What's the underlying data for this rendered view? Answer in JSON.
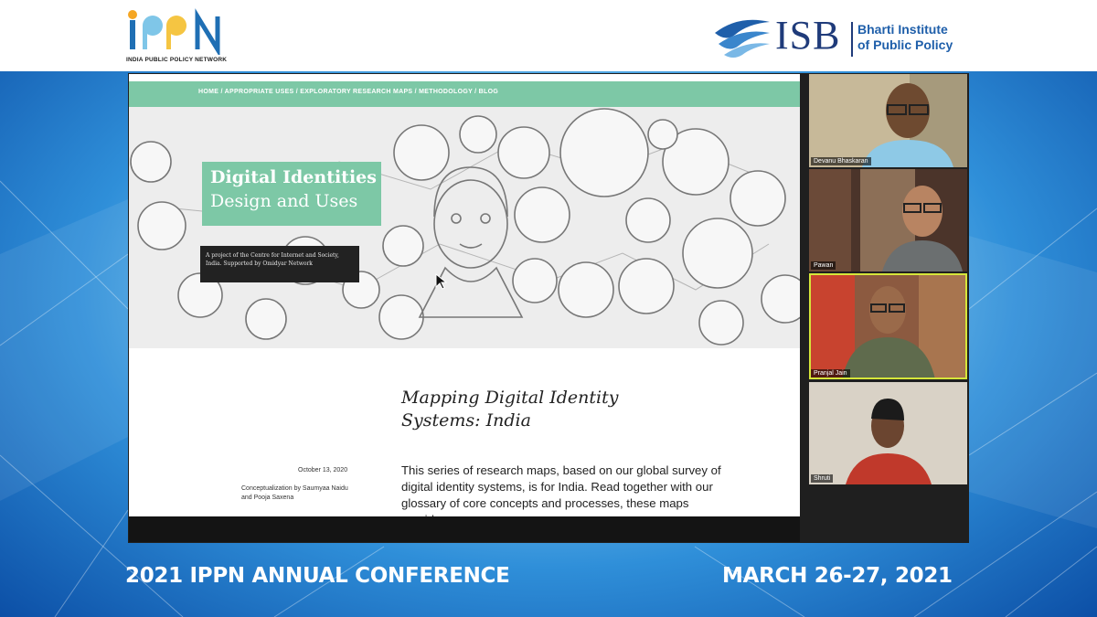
{
  "header": {
    "ippn_logo_text": "iPPN",
    "ippn_tagline": "INDIA PUBLIC POLICY NETWORK",
    "isb_logo_text": "ISB",
    "isb_subtitle_line1": "Bharti Institute",
    "isb_subtitle_line2": "of Public Policy"
  },
  "shared_screen": {
    "nav_links": "HOME / APPROPRIATE USES / EXPLORATORY RESEARCH MAPS / METHODOLOGY / BLOG",
    "hero_title_line1": "Digital Identities",
    "hero_title_line2": "Design and Uses",
    "hero_subtitle": "A project of the Centre for Internet and Society, India. Supported by Omidyar Network",
    "article_title": "Mapping Digital Identity Systems: India",
    "article_date": "October 13, 2020",
    "article_credit": "Conceptualization by Saumyaa Naidu and Pooja Saxena",
    "article_body": "This series of research maps, based on our global survey of digital identity systems, is for India. Read together with our glossary of core concepts and processes, these maps provide a"
  },
  "participants": [
    {
      "name": "Devanu Bhaskaran"
    },
    {
      "name": "Pawan"
    },
    {
      "name": "Pranjal Jain"
    },
    {
      "name": "Shruti"
    }
  ],
  "footer": {
    "event_title": "2021 IPPN ANNUAL CONFERENCE",
    "event_dates": "MARCH 26-27, 2021"
  },
  "colors": {
    "site_green": "#7dc8a6",
    "isb_navy": "#1f3b7a",
    "ippn_blue": "#1f6fb4",
    "active_speaker": "#d6e63a"
  }
}
